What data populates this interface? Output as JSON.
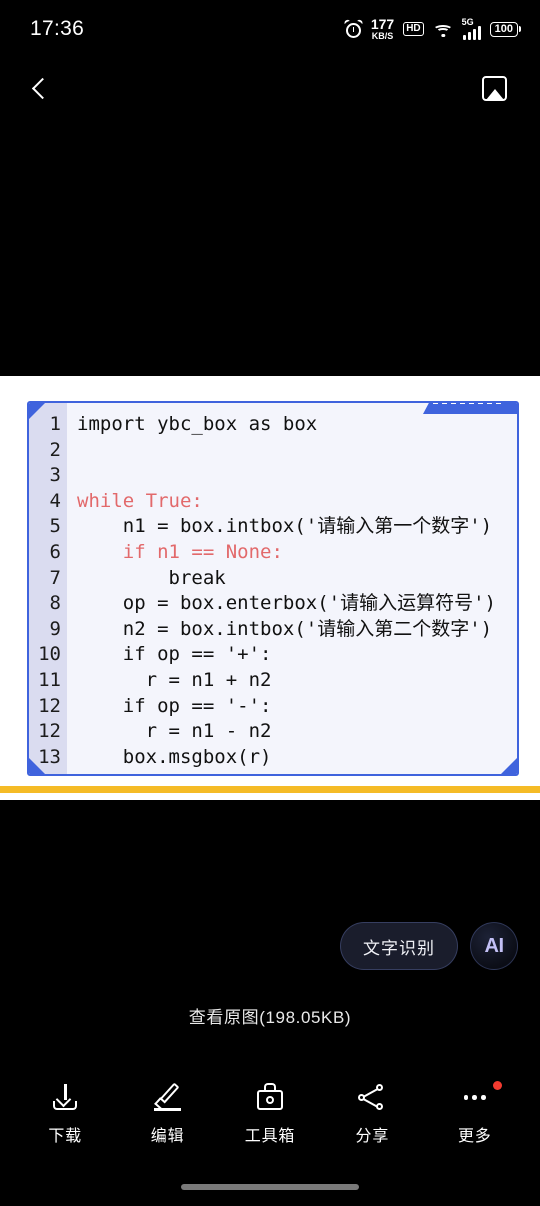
{
  "status_bar": {
    "time": "17:36",
    "alarm_icon": "alarm-clock-icon",
    "net_speed_value": "177",
    "net_speed_unit": "KB/S",
    "hd_badge": "HD",
    "wifi_icon": "wifi-icon",
    "network_type": "5G",
    "signal_icon": "signal-bars-icon",
    "battery_percent": "100"
  },
  "nav_bar": {
    "back_icon": "back-chevron-icon",
    "gallery_icon": "gallery-image-icon"
  },
  "photo": {
    "accent_border_color": "#3f63dd",
    "gutter_color": "#dadcf0",
    "code_bg_color": "#f4f5fc",
    "keyword_color": "#e2696b",
    "underline_bar_color": "#f5bb26",
    "line_numbers": [
      "1",
      "2",
      "3",
      "4",
      "5",
      "6",
      "7",
      "8",
      "9",
      "10",
      "11",
      "12",
      "12",
      "13"
    ],
    "code_lines": [
      {
        "text": "import ybc_box as box",
        "style": "plain"
      },
      {
        "text": "",
        "style": "plain"
      },
      {
        "text": "",
        "style": "plain"
      },
      {
        "text": "while True:",
        "style": "keyword"
      },
      {
        "text": "    n1 = box.intbox('请输入第一个数字')",
        "style": "plain"
      },
      {
        "text": "    if n1 == None:",
        "style": "keyword"
      },
      {
        "text": "        break",
        "style": "plain"
      },
      {
        "text": "    op = box.enterbox('请输入运算符号')",
        "style": "plain"
      },
      {
        "text": "    n2 = box.intbox('请输入第二个数字')",
        "style": "plain"
      },
      {
        "text": "    if op == '+':",
        "style": "plain"
      },
      {
        "text": "      r = n1 + n2",
        "style": "plain"
      },
      {
        "text": "    if op == '-':",
        "style": "plain"
      },
      {
        "text": "      r = n1 - n2",
        "style": "plain"
      },
      {
        "text": "    box.msgbox(r)",
        "style": "plain"
      }
    ]
  },
  "floating": {
    "ocr_label": "文字识别",
    "ai_label": "AI"
  },
  "original_image": {
    "label": "查看原图(198.05KB)"
  },
  "toolbar": {
    "items": [
      {
        "label": "下载",
        "icon": "download-icon"
      },
      {
        "label": "编辑",
        "icon": "pencil-edit-icon"
      },
      {
        "label": "工具箱",
        "icon": "toolbox-icon"
      },
      {
        "label": "分享",
        "icon": "share-nodes-icon"
      },
      {
        "label": "更多",
        "icon": "more-dots-icon"
      }
    ],
    "more_badge_color": "#f33b30"
  }
}
